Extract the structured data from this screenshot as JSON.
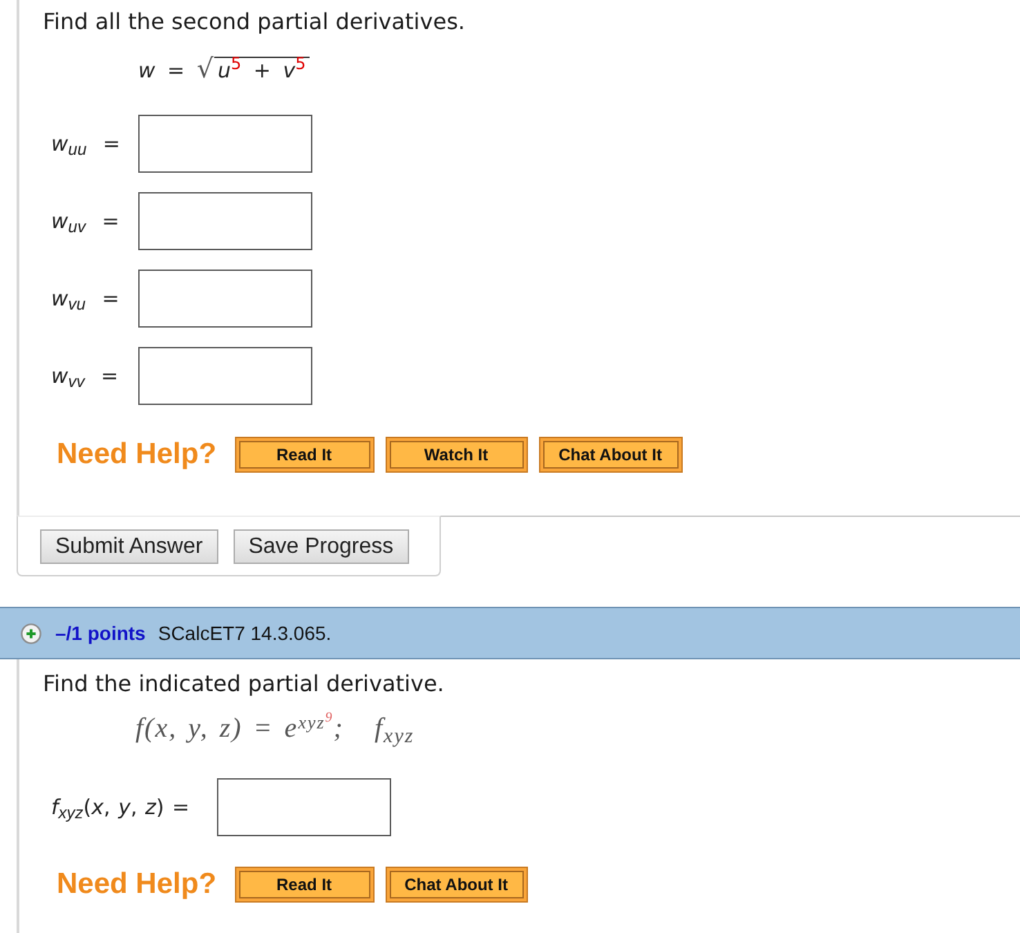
{
  "problems": [
    {
      "prompt": "Find all the second partial derivatives.",
      "equation": {
        "kind": "radical",
        "lhs": "*w* =",
        "radical": "√",
        "radicand": "*u*$^{5}$ + *v*$^{5}$"
      },
      "answers": [
        {
          "label": "*w*$_{uu}$ ="
        },
        {
          "label": "*w*$_{uv}$ ="
        },
        {
          "label": "*w*$_{vu}$ ="
        },
        {
          "label": "*w*$_{vv}$ ="
        }
      ],
      "help": {
        "label": "Need Help?",
        "buttons": [
          "Read It",
          "Watch It",
          "Chat About It"
        ]
      },
      "actions": [
        "Submit Answer",
        "Save Progress"
      ]
    },
    {
      "header": {
        "points": "–/1 points",
        "reference": "SCalcET7 14.3.065."
      },
      "prompt": "Find the indicated partial derivative.",
      "equation": {
        "kind": "exponential",
        "lhs": "f(x, y, z) = e",
        "exponent": "xyz",
        "exponent_power": "9",
        "separator": ";",
        "derivative": "f$_{xyz}$"
      },
      "answers": [
        {
          "label": "*f*$_{xyz}$(*x*, *y*, *z*) ="
        }
      ],
      "help": {
        "label": "Need Help?",
        "buttons": [
          "Read It",
          "Chat About It"
        ]
      }
    }
  ]
}
